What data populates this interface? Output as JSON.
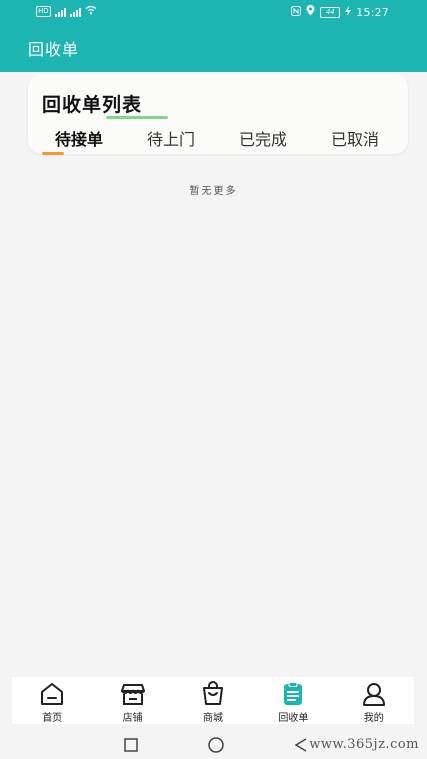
{
  "status_bar": {
    "left_badge_1": "HD",
    "left_badge_2": "4G",
    "battery": "44",
    "time": "15:27"
  },
  "header": {
    "title": "回收单"
  },
  "card": {
    "title": "回收单列表",
    "tabs": [
      {
        "label": "待接单",
        "active": true
      },
      {
        "label": "待上门",
        "active": false
      },
      {
        "label": "已完成",
        "active": false
      },
      {
        "label": "已取消",
        "active": false
      }
    ],
    "indicator_color": "#f39a2b"
  },
  "content": {
    "empty_text": "暂无更多"
  },
  "bottom_nav": {
    "items": [
      {
        "label": "首页",
        "icon": "home-icon",
        "active": false
      },
      {
        "label": "店铺",
        "icon": "store-icon",
        "active": false
      },
      {
        "label": "商城",
        "icon": "shopping-bag-icon",
        "active": false
      },
      {
        "label": "回收单",
        "icon": "clipboard-icon",
        "active": true
      },
      {
        "label": "我的",
        "icon": "user-icon",
        "active": false
      }
    ]
  },
  "watermark": "www.365jz.com",
  "colors": {
    "accent": "#1db5b2",
    "active_tab_indicator": "#f39a2b",
    "background": "#f5f4f4"
  }
}
